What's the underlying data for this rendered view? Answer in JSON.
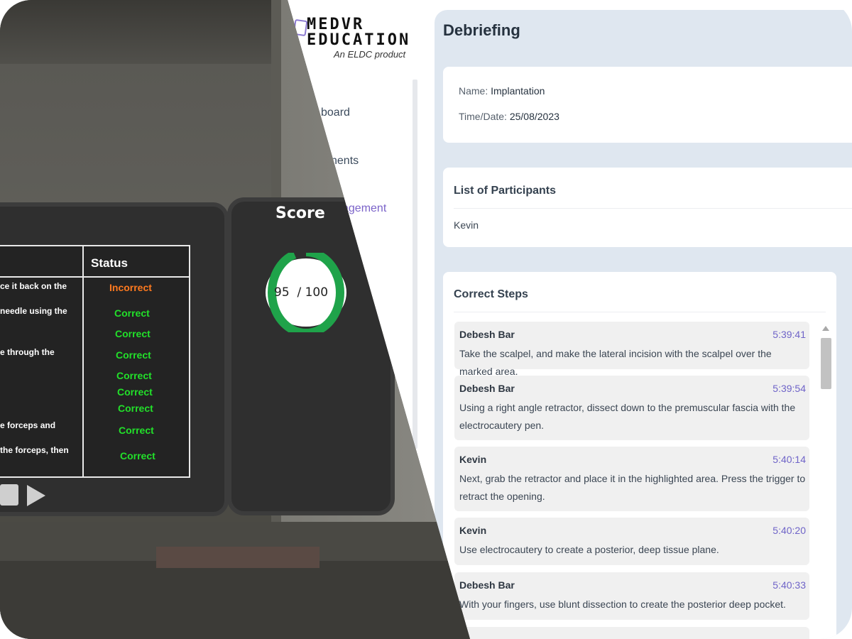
{
  "brand": {
    "line1": "MEDVR",
    "line2": "EDUCATION",
    "tagline": "An ELDC product"
  },
  "sidebar": {
    "items": [
      {
        "label": "board"
      },
      {
        "label": "nents"
      },
      {
        "label": "agement"
      }
    ]
  },
  "debriefing": {
    "title": "Debriefing",
    "info": {
      "name_label": "Name:",
      "name_value": "Implantation",
      "date_label": "Time/Date:",
      "date_value": "25/08/2023"
    },
    "participants": {
      "title": "List of Participants",
      "names": [
        "Kevin"
      ]
    },
    "correct_steps": {
      "title": "Correct Steps",
      "items": [
        {
          "author": "Debesh Bar",
          "time": "5:39:41",
          "text": "Take the scalpel, and make the lateral incision with the scalpel over the marked area."
        },
        {
          "author": "Debesh Bar",
          "time": "5:39:54",
          "text": "Using a right angle retractor, dissect down to the premuscular fascia with the electrocautery pen."
        },
        {
          "author": "Kevin",
          "time": "5:40:14",
          "text": "Next, grab the retractor and place it in the highlighted area. Press the trigger to retract the opening."
        },
        {
          "author": "Kevin",
          "time": "5:40:20",
          "text": "Use electrocautery to create a posterior, deep tissue plane."
        },
        {
          "author": "Debesh Bar",
          "time": "5:40:33",
          "text": "With your fingers, use blunt dissection to create the posterior deep pocket."
        }
      ]
    }
  },
  "vr": {
    "status_header": "Status",
    "step_fragments": [
      "ce it back on the",
      "needle using the",
      "e through the",
      "e forceps and",
      "the forceps, then"
    ],
    "statuses": [
      "Incorrect",
      "Correct",
      "Correct",
      "Correct",
      "Correct",
      "Correct",
      "Correct",
      "Correct",
      "Correct"
    ],
    "score": {
      "title": "Score",
      "value": "95",
      "max": "/ 100",
      "value_num": 95,
      "max_num": 100,
      "ring_color": "#1fa34a"
    }
  }
}
